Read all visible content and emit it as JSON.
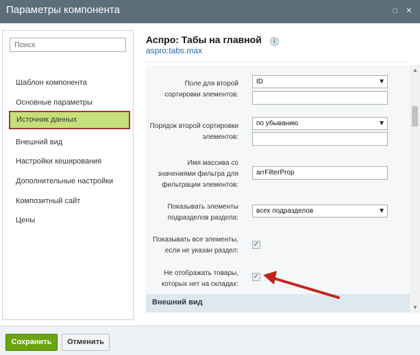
{
  "window": {
    "title": "Параметры компонента"
  },
  "sidebar": {
    "search_placeholder": "Поиск",
    "items": [
      {
        "label": "Шаблон компонента"
      },
      {
        "label": "Основные параметры"
      },
      {
        "label": "Источник данных",
        "active": true
      },
      {
        "label": "Внешний вид"
      },
      {
        "label": "Настройки кеширования"
      },
      {
        "label": "Дополнительные настройки"
      },
      {
        "label": "Композитный сайт"
      },
      {
        "label": "Цены"
      }
    ]
  },
  "component": {
    "title": "Аспро: Табы на главной",
    "code": "aspro:tabs.max"
  },
  "fields": {
    "sort2_field": {
      "label1": "Поле для второй",
      "label2": "сортировки элементов:",
      "value": "ID"
    },
    "sort2_order": {
      "label1": "Порядок второй сортировки",
      "label2": "элементов:",
      "value": "по убыванию"
    },
    "filter_name": {
      "label1": "Имя массива со",
      "label2": "значениями фильтра для",
      "label3": "фильтрации элементов:",
      "value": "arrFilterProp"
    },
    "include_subsections": {
      "label1": "Показывать элементы",
      "label2": "подразделов раздела:",
      "value": "всех подразделов"
    },
    "show_all": {
      "label1": "Показывать все элементы,",
      "label2": "если не указан раздел:",
      "checked": true
    },
    "hide_not_available": {
      "label1": "Не отображать товары,",
      "label2": "которых нет на складах:",
      "checked": true
    }
  },
  "section": {
    "title": "Внешний вид"
  },
  "footer": {
    "save_label": "Сохранить",
    "cancel_label": "Отменить"
  },
  "colors": {
    "titlebar": "#5c6e7a",
    "active_item_bg": "#c5e07a",
    "active_item_border": "#a03a2e",
    "save_button": "#6aa30d",
    "annotation_arrow": "#c0261c"
  }
}
